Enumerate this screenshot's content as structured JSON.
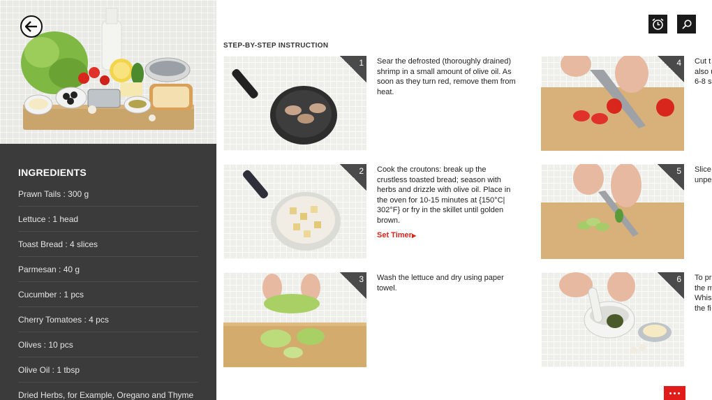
{
  "header": {
    "section_title": "STEP-BY-STEP INSTRUCTION"
  },
  "icons": {
    "back": "back-arrow-icon",
    "alarm": "alarm-clock-icon",
    "search": "search-icon",
    "more": "more-dots-icon"
  },
  "ingredients": {
    "title": "INGREDIENTS",
    "items": [
      "Prawn Tails : 300 g",
      "Lettuce : 1 head",
      "Toast Bread : 4 slices",
      "Parmesan : 40 g",
      "Cucumber : 1 pcs",
      "Cherry Tomatoes : 4 pcs",
      "Olives : 10 pcs",
      "Olive Oil : 1 tbsp",
      "Dried Herbs, for Example, Oregano and Thyme"
    ]
  },
  "steps": [
    {
      "num": "1",
      "text": "Sear the defrosted (thoroughly drained) shrimp in a small amount of olive oil. As soon as they turn red, remove them from heat."
    },
    {
      "num": "2",
      "text": "Cook the croutons: break up the crustless toasted bread; season with herbs and drizzle with olive oil. Place in the oven for 10-15 minutes at {150°C| 302°F} or fry in the skillet until golden brown.",
      "timer_label": "Set Timer"
    },
    {
      "num": "3",
      "text": "Wash the lettuce and dry using paper towel."
    },
    {
      "num": "4",
      "text": "Cut t\nalso u\n6-8 s"
    },
    {
      "num": "5",
      "text": "Slice\nunpe"
    },
    {
      "num": "6",
      "text": "To pr\nthe m\nWhis\nthe fi"
    }
  ],
  "colors": {
    "accent_red": "#d4261c",
    "panel_dark": "#3b3b3b",
    "icon_bg": "#1a1a1a",
    "more_button": "#e21b1b"
  }
}
